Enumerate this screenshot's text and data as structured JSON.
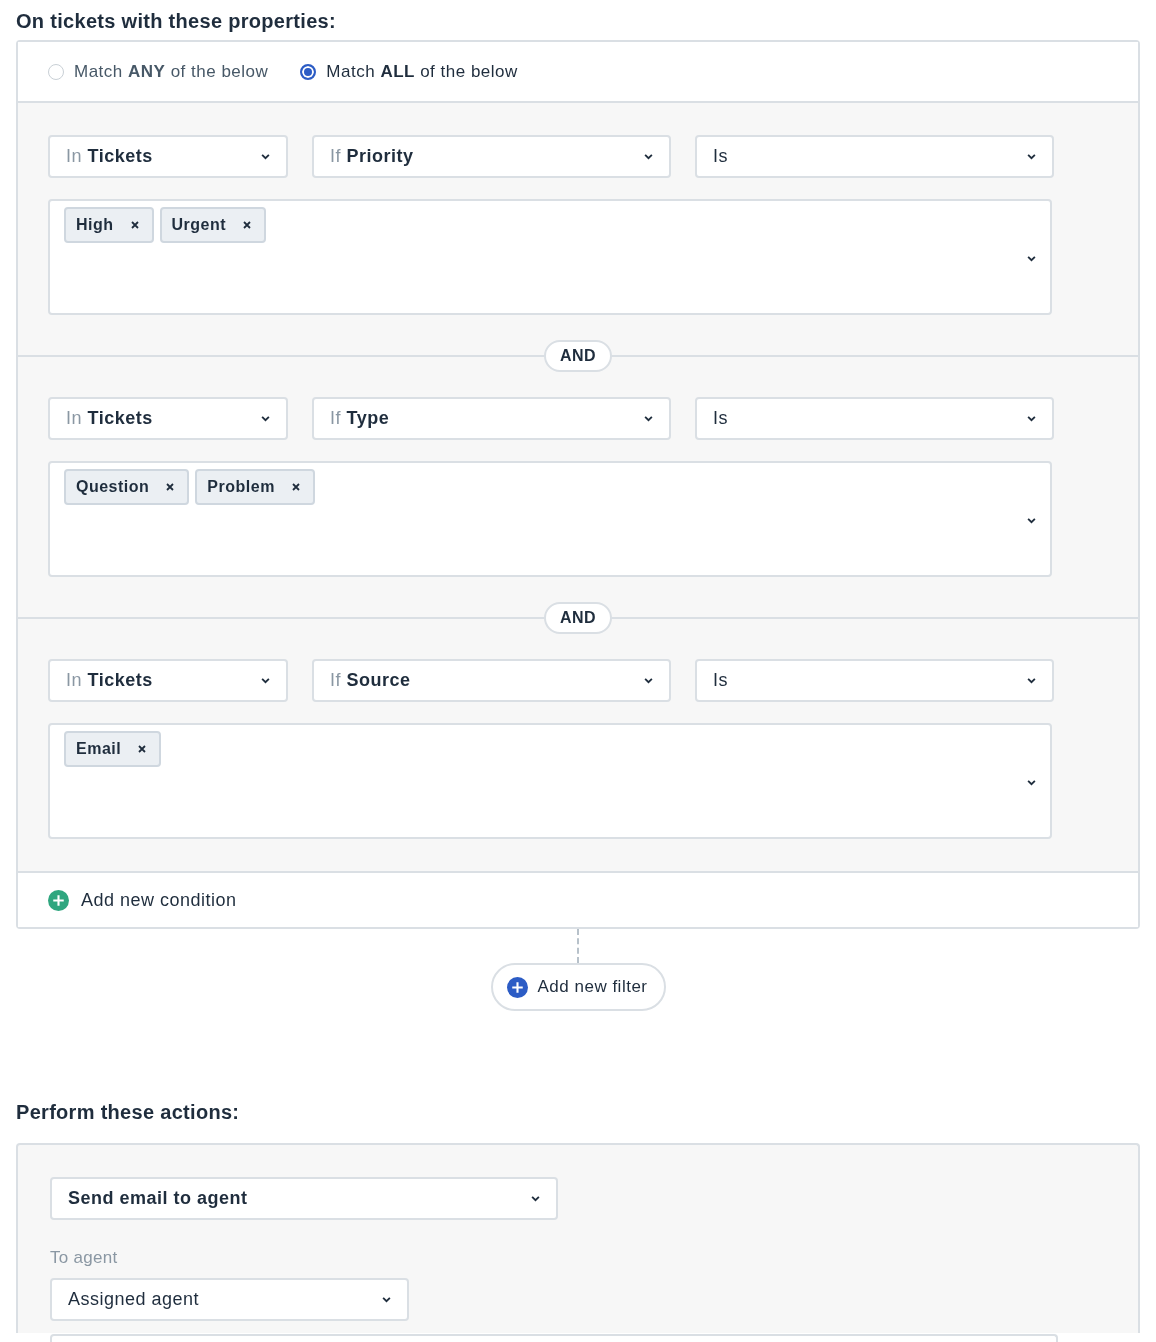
{
  "conditions_heading": "On tickets with these properties:",
  "match_options": [
    {
      "label": "Match **ANY** of the below",
      "selected": false
    },
    {
      "label": "Match **ALL** of the below",
      "selected": true
    }
  ],
  "conditions": [
    {
      "scope": {
        "prefix": "In",
        "value": "Tickets"
      },
      "field": {
        "prefix": "If",
        "value": "Priority"
      },
      "operator": {
        "value": "Is"
      },
      "tags": [
        "High",
        "Urgent"
      ]
    },
    {
      "connector": "AND",
      "scope": {
        "prefix": "In",
        "value": "Tickets"
      },
      "field": {
        "prefix": "If",
        "value": "Type"
      },
      "operator": {
        "value": "Is"
      },
      "tags": [
        "Question",
        "Problem"
      ]
    },
    {
      "connector": "AND",
      "scope": {
        "prefix": "In",
        "value": "Tickets"
      },
      "field": {
        "prefix": "If",
        "value": "Source"
      },
      "operator": {
        "value": "Is"
      },
      "tags": [
        "Email"
      ]
    }
  ],
  "add_condition": "Add new condition",
  "add_filter": "Add new filter",
  "actions_heading": "Perform these actions:",
  "action": {
    "value": "Send email to agent"
  },
  "to_agent": {
    "label": "To agent",
    "value": "Assigned agent"
  }
}
